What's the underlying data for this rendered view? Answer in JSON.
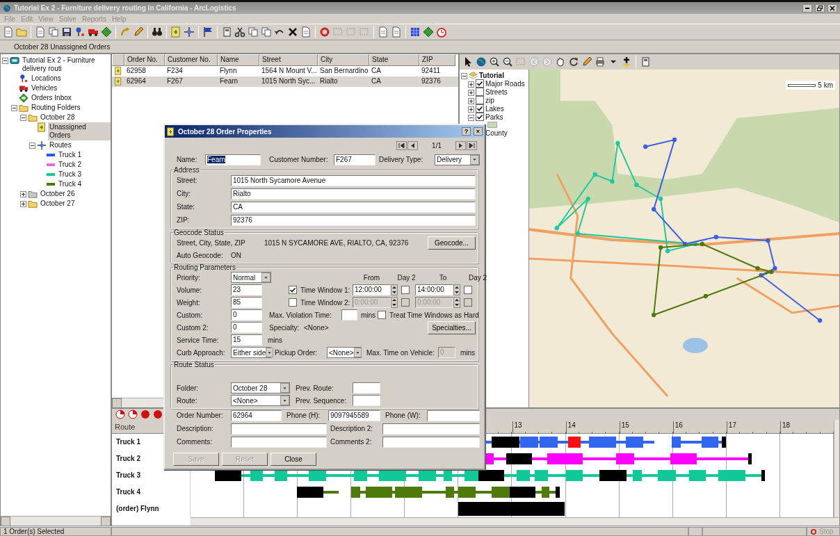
{
  "window": {
    "title": "Tutorial Ex 2 - Furniture delivery routing in California - ArcLogistics"
  },
  "menu": [
    "File",
    "Edit",
    "View",
    "Solve",
    "Reports",
    "Help"
  ],
  "breadcrumb": "October 28 Unassigned Orders",
  "tree": {
    "label": "Tutorial Ex 2 - Furniture delivery routi",
    "kind": "project",
    "expanded": true,
    "selected": false,
    "children": [
      {
        "label": "Locations",
        "kind": "locations",
        "selected": false
      },
      {
        "label": "Vehicles",
        "kind": "vehicles",
        "selected": false
      },
      {
        "label": "Orders Inbox",
        "kind": "inbox",
        "selected": false
      },
      {
        "label": "Routing Folders",
        "kind": "folders",
        "expanded": true,
        "selected": false,
        "children": [
          {
            "label": "October 28",
            "kind": "folder",
            "expanded": true,
            "selected": false,
            "children": [
              {
                "label": "Unassigned Orders",
                "kind": "orders",
                "selected": true
              },
              {
                "label": "Routes",
                "kind": "routes",
                "expanded": true,
                "selected": false,
                "children": [
                  {
                    "label": "Truck 1",
                    "kind": "route",
                    "color": "#2f55e8",
                    "selected": false
                  },
                  {
                    "label": "Truck 2",
                    "kind": "route",
                    "color": "#e070e0",
                    "selected": false
                  },
                  {
                    "label": "Truck 3",
                    "kind": "route",
                    "color": "#18c49a",
                    "selected": false
                  },
                  {
                    "label": "Truck 4",
                    "kind": "route",
                    "color": "#4d7a0a",
                    "selected": false
                  }
                ]
              }
            ]
          },
          {
            "label": "October 26",
            "kind": "archive",
            "expanded": false,
            "selected": false
          },
          {
            "label": "October 27",
            "kind": "folder",
            "expanded": false,
            "selected": false
          }
        ]
      }
    ]
  },
  "orders": {
    "columns": [
      "Order No.",
      "Customer No.",
      "Name",
      "Street",
      "City",
      "State",
      "ZIP"
    ],
    "rows": [
      {
        "selected": false,
        "cells": [
          "62958",
          "F234",
          "Flynn",
          "1564 N Mount V...",
          "San Bernardino",
          "CA",
          "92411"
        ]
      },
      {
        "selected": true,
        "cells": [
          "62964",
          "F267",
          "Fearn",
          "1015 North Syc...",
          "Rialto",
          "CA",
          "92376"
        ]
      }
    ]
  },
  "map": {
    "layers": {
      "label": "Tutorial",
      "expanded": true,
      "children": [
        {
          "label": "Major Roads",
          "expanded": false,
          "checked": true
        },
        {
          "label": "Streets",
          "expanded": false,
          "checked": false
        },
        {
          "label": "zip",
          "expanded": false,
          "checked": false
        },
        {
          "label": "Lakes",
          "expanded": false,
          "checked": true
        },
        {
          "label": "Parks",
          "expanded": true,
          "checked": true
        },
        {
          "label": "County"
        }
      ]
    },
    "scale": "5 km"
  },
  "schedule": {
    "header": "Route",
    "ticks": [
      "13",
      "14",
      "15",
      "16",
      "17",
      "18"
    ],
    "rows": [
      {
        "name": "Truck 1",
        "color": "#3366ee"
      },
      {
        "name": "Truck 2",
        "color": "#ff00ff"
      },
      {
        "name": "Truck 3",
        "color": "#11c899"
      },
      {
        "name": "Truck 4",
        "color": "#4d7a0a"
      },
      {
        "name": "(order) Flynn"
      }
    ]
  },
  "dialog": {
    "title": "October 28 Order Properties",
    "title_buttons": [
      "?",
      "×"
    ],
    "position": "1/1",
    "name": {
      "label": "Name:",
      "value": "Fearn",
      "selected": true
    },
    "customer_number": {
      "label": "Customer Number:",
      "value": "F267"
    },
    "delivery_type": {
      "label": "Delivery Type:",
      "value": "Delivery"
    },
    "address": {
      "title": "Address",
      "fields": [
        {
          "label": "Street:",
          "value": "1015 North Sycamore Avenue"
        },
        {
          "label": "City:",
          "value": "Rialto"
        },
        {
          "label": "State:",
          "value": "CA"
        },
        {
          "label": "ZIP:",
          "value": "92376"
        }
      ]
    },
    "geocode": {
      "title": "Geocode Status",
      "match_label": "Street, City, State, ZIP",
      "match_address": "1015 N SYCAMORE AVE, RIALTO, CA, 92376",
      "auto_label": "Auto Geocode:",
      "auto_value": "ON",
      "button": "Geocode..."
    },
    "routing": {
      "title": "Routing Parameters",
      "priority": {
        "label": "Priority:",
        "value": "Normal"
      },
      "headers": [
        "From",
        "Day 2",
        "To",
        "Day 2"
      ],
      "volume": {
        "label": "Volume:",
        "value": "23"
      },
      "weight": {
        "label": "Weight:",
        "value": "85"
      },
      "time_windows": [
        {
          "label": "Time Window 1:",
          "checked": true,
          "from": "12:00:00",
          "from_day2": false,
          "to": "14:00:00",
          "to_day2": false
        },
        {
          "label": "Time Window 2:",
          "checked": false,
          "from": "0:00:00",
          "from_day2": false,
          "to": "0:00:00",
          "to_day2": false
        }
      ],
      "custom": {
        "label": "Custom:",
        "value": "0"
      },
      "max_violation": {
        "label": "Max. Violation Time:",
        "unit": "mins"
      },
      "treat_hard": {
        "label": "Treat Time Windows as Hard",
        "checked": false
      },
      "custom2": {
        "label": "Custom 2:",
        "value": "0"
      },
      "specialty": {
        "label": "Specialty:",
        "value": "<None>"
      },
      "specialties_button": "Specialties...",
      "service_time": {
        "label": "Service Time:",
        "value": "15",
        "unit": "mins"
      },
      "curb_approach": {
        "label": "Curb Approach:",
        "value": "Either side"
      },
      "pickup_order": {
        "label": "Pickup Order:",
        "value": "<None>"
      },
      "max_time_on_vehicle": {
        "label": "Max. Time on Vehicle:",
        "value": "0",
        "unit": "mins",
        "disabled": true
      }
    },
    "route_status": {
      "title": "Route Status",
      "folder": {
        "label": "Folder:",
        "value": "October 28"
      },
      "prev_route": {
        "label": "Prev. Route:"
      },
      "route": {
        "label": "Route:",
        "value": "<None>"
      },
      "prev_sequence": {
        "label": "Prev. Sequence:"
      }
    },
    "details": {
      "order_number": {
        "label": "Order Number:",
        "value": "62964"
      },
      "phone_h": {
        "label": "Phone (H):",
        "value": "9097945589"
      },
      "phone_w": {
        "label": "Phone (W):"
      },
      "description": {
        "label": "Description:"
      },
      "description2": {
        "label": "Description 2:"
      },
      "comments": {
        "label": "Comments:"
      },
      "comments2": {
        "label": "Comments 2:"
      }
    },
    "buttons": [
      {
        "label": "Save",
        "disabled": true
      },
      {
        "label": "Reset",
        "disabled": true
      },
      {
        "label": "Close",
        "disabled": false
      }
    ]
  },
  "status_bar": {
    "message": "1 Order(s) Selected",
    "stop": "Stop"
  }
}
